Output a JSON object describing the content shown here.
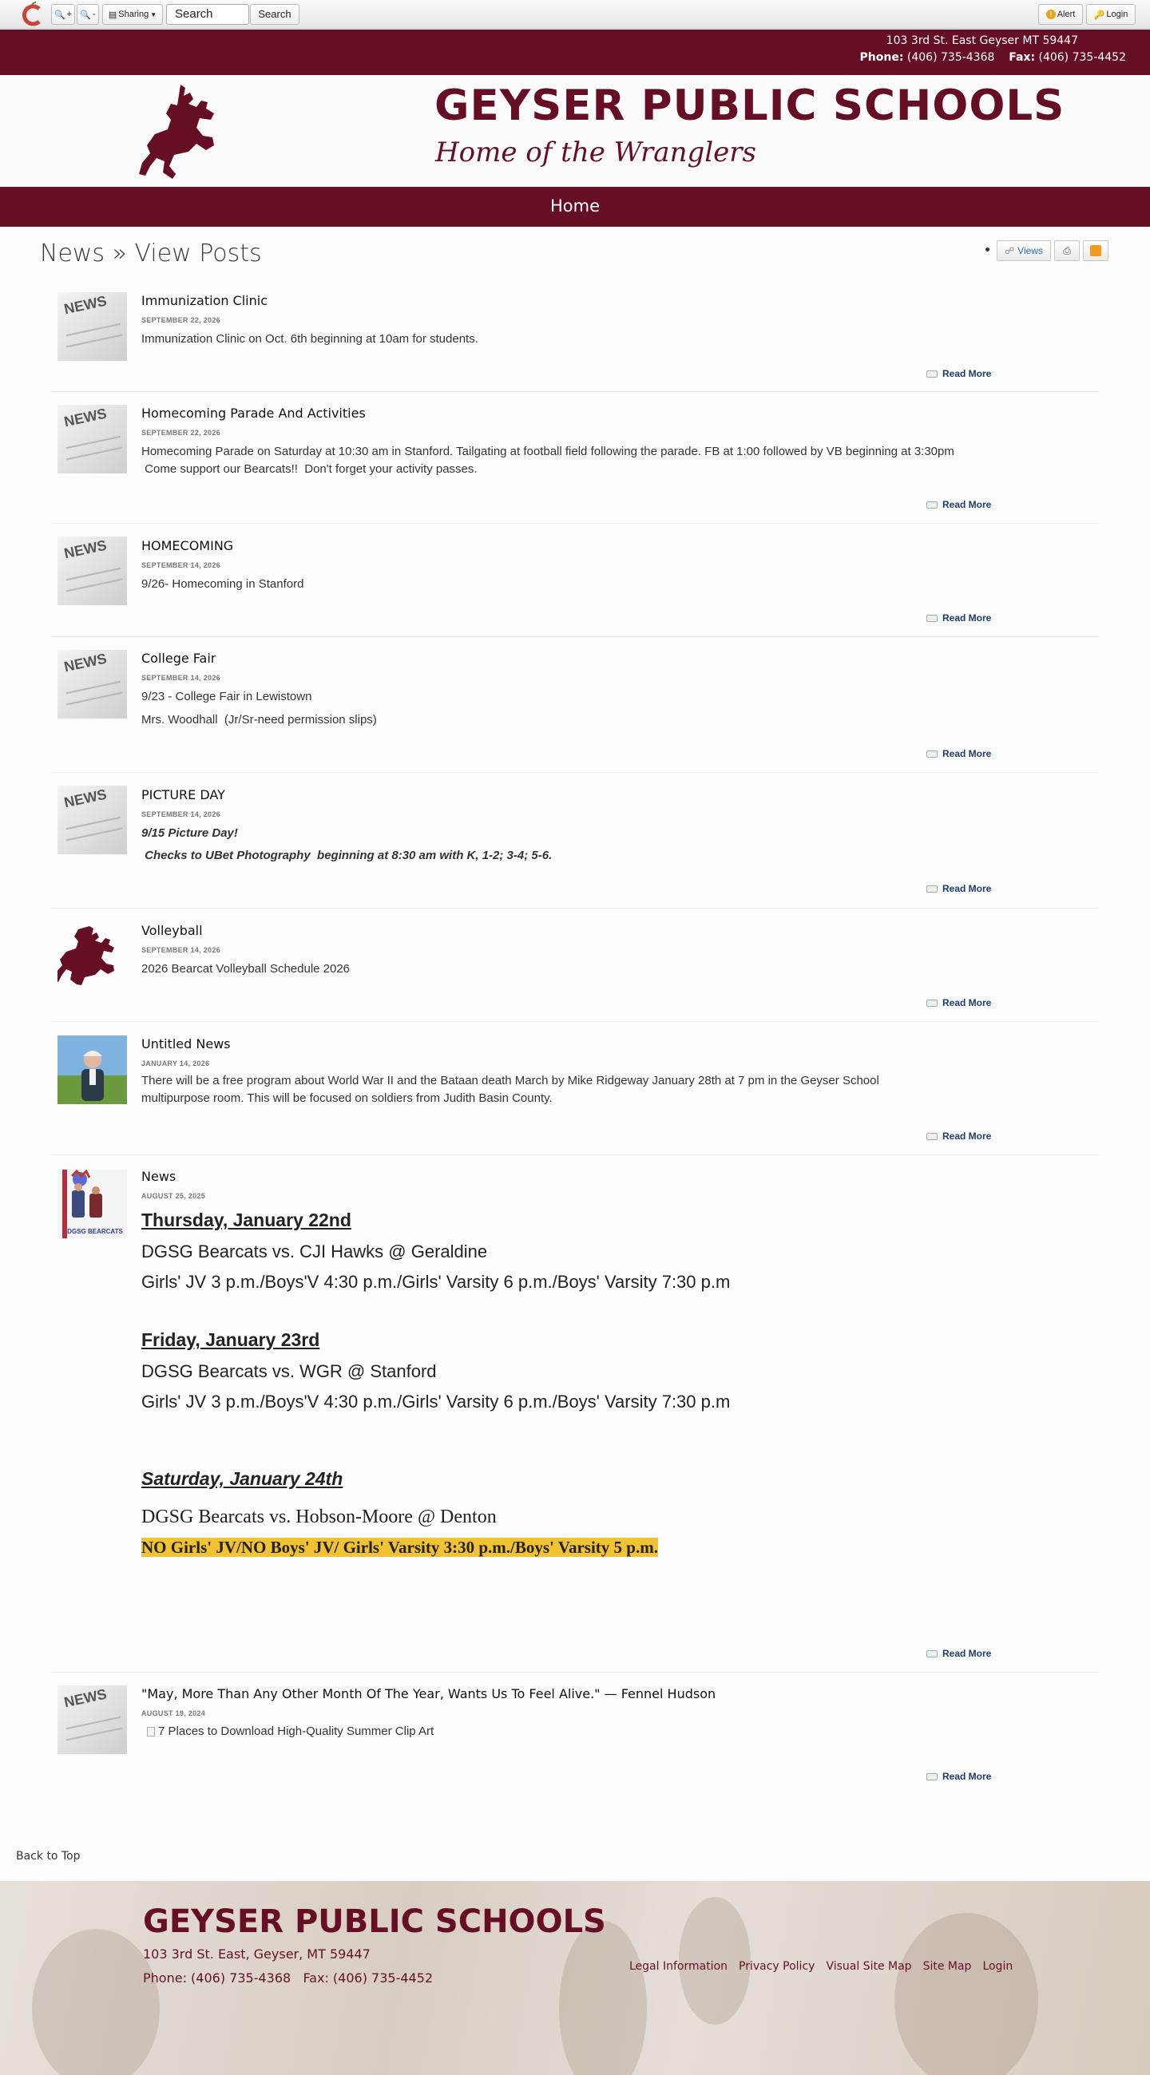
{
  "toolbar": {
    "logo_icon": "apple-c-icon",
    "zoom_in": "+",
    "zoom_out": "-",
    "sharing": "Sharing",
    "search_value": "Search",
    "search_button": "Search",
    "alert": "Alert",
    "login": "Login"
  },
  "contact": {
    "address": "103 3rd St. East   Geyser  MT 59447",
    "phone_label": "Phone:",
    "phone": "(406) 735-4368",
    "fax_label": "Fax:",
    "fax": "(406) 735-4452"
  },
  "header": {
    "school_name": "GEYSER PUBLIC SCHOOLS",
    "tagline": "Home of the Wranglers",
    "brand_color": "#660f24"
  },
  "nav": {
    "home": "Home"
  },
  "page": {
    "title": "News » View Posts",
    "views": "Views"
  },
  "posts": [
    {
      "title": "Immunization Clinic",
      "date": "SEPTEMBER 22, 2026",
      "lines": [
        "Immunization Clinic on Oct. 6th beginning at 10am for students."
      ],
      "read_more": "Read More"
    },
    {
      "title": "Homecoming Parade And Activities",
      "date": "SEPTEMBER 22, 2026",
      "lines": [
        "Homecoming Parade on Saturday at 10:30 am in Stanford.  Tailgating at football field following the parade.  FB at 1:00 followed by VB beginning at 3:30pm",
        " Come support our Bearcats!!  Don't forget your activity passes."
      ],
      "read_more": "Read More"
    },
    {
      "title": "HOMECOMING",
      "date": "SEPTEMBER 14, 2026",
      "lines": [
        "9/26- Homecoming in Stanford"
      ],
      "read_more": "Read More"
    },
    {
      "title": "College Fair",
      "date": "SEPTEMBER 14, 2026",
      "lines": [
        "9/23 - College Fair in Lewistown",
        "Mrs. Woodhall  (Jr/Sr-need permission slips)"
      ],
      "read_more": "Read More"
    },
    {
      "title": "PICTURE DAY",
      "date": "SEPTEMBER 14, 2026",
      "lines": [
        "9/15 Picture Day!",
        " Checks to UBet Photography  beginning at 8:30 am with K, 1-2; 3-4; 5-6."
      ],
      "read_more": "Read More"
    },
    {
      "title": "Volleyball",
      "date": "SEPTEMBER 14, 2026",
      "lines": [
        "2026 Bearcat Volleyball Schedule 2026"
      ],
      "read_more": "Read More"
    },
    {
      "title": "Untitled News",
      "date": "JANUARY 14, 2026",
      "lines": [
        "There will be a free program about World War II and the Bataan death March by Mike Ridgeway January 28th at 7 pm in the Geyser School",
        "multipurpose room. This will be focused on soldiers from Judith Basin County."
      ],
      "read_more": "Read More"
    },
    {
      "title": "News",
      "date": "AUGUST 25, 2025",
      "thumb_text": "DGSG BEARCATS",
      "read_more": "Read More",
      "schedule": [
        {
          "day": "Thursday, January 22nd",
          "matchup": "DGSG Bearcats vs. CJI Hawks @ Geraldine",
          "times": "Girls' JV 3 p.m./Boys'V 4:30 p.m./Girls' Varsity 6 p.m./Boys' Varsity 7:30 p.m"
        },
        {
          "day": "Friday, January 23rd",
          "matchup": "DGSG Bearcats vs. WGR @ Stanford",
          "times": "Girls' JV 3 p.m./Boys'V 4:30 p.m./Girls' Varsity 6 p.m./Boys' Varsity 7:30 p.m"
        },
        {
          "day": "Saturday, January 24th",
          "matchup": "DGSG Bearcats vs. Hobson-Moore @ Denton",
          "times": "NO Girls' JV/NO Boys' JV/ Girls' Varsity 3:30 p.m./Boys' Varsity 5 p.m."
        }
      ]
    },
    {
      "title": "\"May, More Than Any Other Month Of The Year, Wants Us To Feel Alive.\" — Fennel Hudson",
      "date": "AUGUST 19, 2024",
      "lines": [
        "7 Places to Download High-Quality Summer Clip Art"
      ],
      "read_more": "Read More"
    }
  ],
  "back_to_top": "Back to Top",
  "footer": {
    "school_name": "GEYSER PUBLIC SCHOOLS",
    "address": "103 3rd St. East, Geyser, MT 59447",
    "phone": "Phone: (406) 735-4368   Fax: (406) 735-4452",
    "links": [
      "Legal Information",
      "Privacy Policy",
      "Visual Site Map",
      "Site Map",
      "Login"
    ]
  },
  "news_thumb_label": "NEWS"
}
